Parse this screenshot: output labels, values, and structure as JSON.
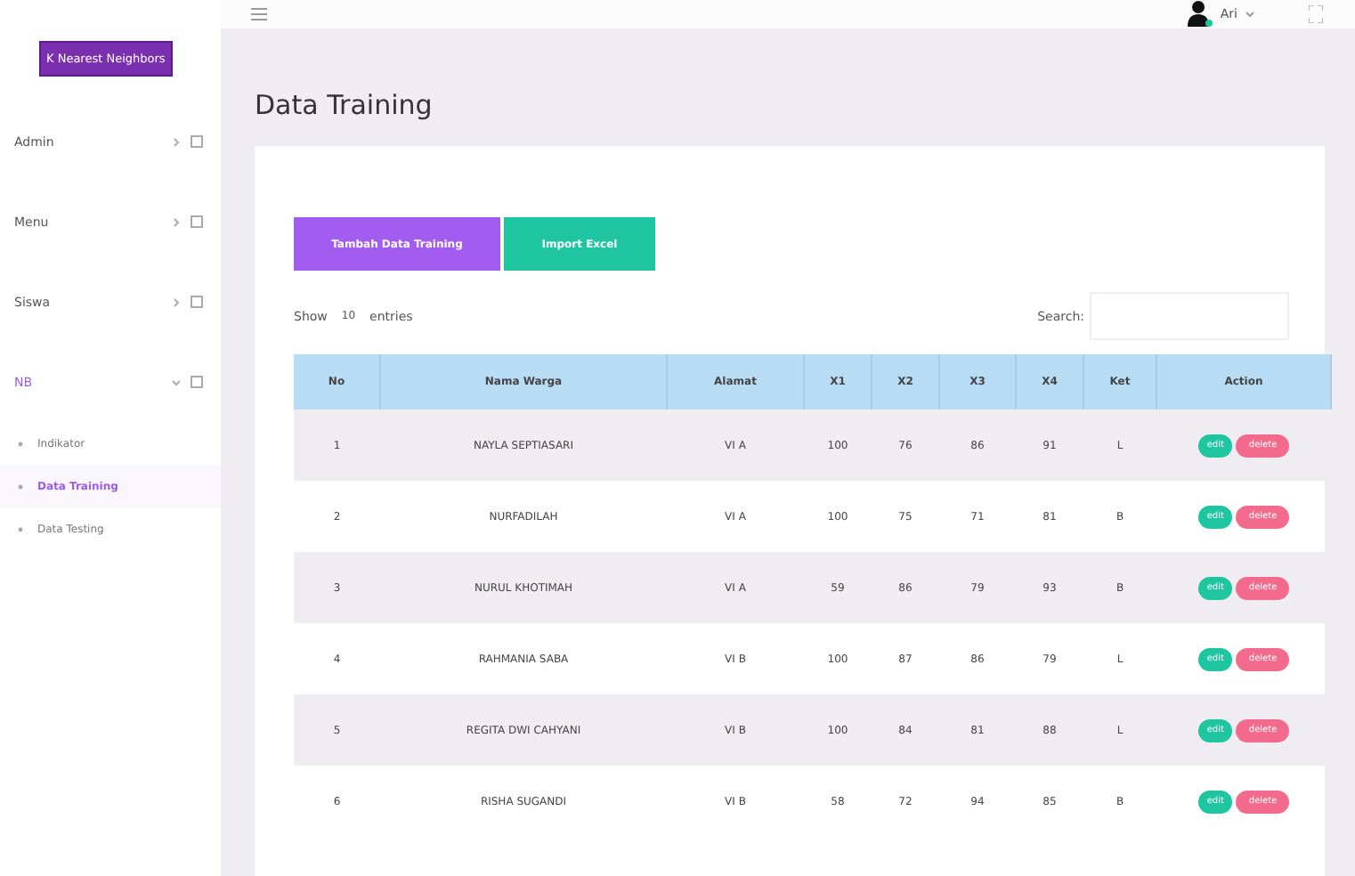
{
  "brand": "K Nearest Neighbors",
  "topbar": {
    "user": "Ari"
  },
  "sidebar": {
    "items": [
      {
        "label": "Admin",
        "selected": false,
        "expanded": false
      },
      {
        "label": "Menu",
        "selected": false,
        "expanded": false
      },
      {
        "label": "Siswa",
        "selected": false,
        "expanded": false
      },
      {
        "label": "NB",
        "selected": true,
        "expanded": true,
        "children": [
          {
            "label": "Indikator",
            "selected": false
          },
          {
            "label": "Data Training",
            "selected": true
          },
          {
            "label": "Data Testing",
            "selected": false
          }
        ]
      }
    ]
  },
  "page_title": "Data Training",
  "buttons": [
    {
      "label": "Tambah Data Training",
      "kind": "primary"
    },
    {
      "label": "Import Excel",
      "kind": "success"
    }
  ],
  "length": {
    "before": "Show",
    "value": "10",
    "after": "entries"
  },
  "search": {
    "label": "Search:"
  },
  "table": {
    "columns": [
      "No",
      "Nama Warga",
      "Alamat",
      "X1",
      "X2",
      "X3",
      "X4",
      "Ket",
      "Action"
    ],
    "rows": [
      {
        "cells": [
          "1",
          "NAYLA SEPTIASARI",
          "VI A",
          "100",
          "76",
          "86",
          "91",
          "L"
        ],
        "actions": [
          "edit",
          "delete"
        ]
      },
      {
        "cells": [
          "2",
          "NURFADILAH",
          "VI A",
          "100",
          "75",
          "71",
          "81",
          "B"
        ],
        "actions": [
          "edit",
          "delete"
        ]
      },
      {
        "cells": [
          "3",
          "NURUL KHOTIMAH",
          "VI A",
          "59",
          "86",
          "79",
          "93",
          "B"
        ],
        "actions": [
          "edit",
          "delete"
        ]
      },
      {
        "cells": [
          "4",
          "RAHMANIA SABA",
          "VI B",
          "100",
          "87",
          "86",
          "79",
          "L"
        ],
        "actions": [
          "edit",
          "delete"
        ]
      },
      {
        "cells": [
          "5",
          "REGITA DWI CAHYANI",
          "VI B",
          "100",
          "84",
          "81",
          "88",
          "L"
        ],
        "actions": [
          "edit",
          "delete"
        ]
      },
      {
        "cells": [
          "6",
          "RISHA SUGANDI",
          "VI B",
          "58",
          "72",
          "94",
          "85",
          "B"
        ],
        "actions": [
          "edit",
          "delete"
        ]
      }
    ]
  }
}
